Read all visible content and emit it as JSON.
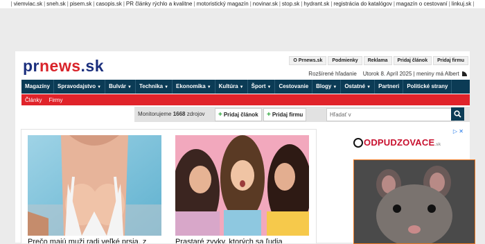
{
  "top_links": [
    "viemviac.sk",
    "sneh.sk",
    "pisem.sk",
    "casopis.sk",
    "PR články rýchlo a kvalitne",
    "motoristický magazín",
    "novinar.sk",
    "stop.sk",
    "hydrant.sk",
    "registrácia do katalógov",
    "magazín o cestovaní",
    "linkuj.sk"
  ],
  "logo": {
    "pr": "pr",
    "news": "news",
    "dot": ".",
    "sk": "sk"
  },
  "top_nav": [
    "O Prnews.sk",
    "Podmienky",
    "Reklama",
    "Pridaj článok",
    "Pridaj firmu"
  ],
  "meta": {
    "advanced_search": "Rozšírené hľadanie",
    "date": "Utorok 8. Apríl 2025",
    "separator": "|",
    "nameday": "meniny má Albert"
  },
  "main_nav": [
    {
      "label": "Magazíny",
      "dropdown": false
    },
    {
      "label": "Spravodajstvo",
      "dropdown": true
    },
    {
      "label": "Bulvár",
      "dropdown": true
    },
    {
      "label": "Technika",
      "dropdown": true
    },
    {
      "label": "Ekonomika",
      "dropdown": true
    },
    {
      "label": "Kultúra",
      "dropdown": true
    },
    {
      "label": "Šport",
      "dropdown": true
    },
    {
      "label": "Cestovanie",
      "dropdown": false
    },
    {
      "label": "Blogy",
      "dropdown": true
    },
    {
      "label": "Ostatné",
      "dropdown": true
    },
    {
      "label": "Partneri",
      "dropdown": false
    },
    {
      "label": "Politické strany",
      "dropdown": false
    }
  ],
  "sub_nav": [
    "Články",
    "Firmy"
  ],
  "toolbar": {
    "monitor_prefix": "Monitorujeme",
    "monitor_count": "1668",
    "monitor_suffix": "zdrojov",
    "add_article": "Pridaj článok",
    "add_company": "Pridaj firmu",
    "search_placeholder": "Hľadať v"
  },
  "articles": [
    {
      "title": "Prečo majú muži radi veľké prsia, z"
    },
    {
      "title": "Prastaré zvyky, ktorých sa ľudia"
    }
  ],
  "ad": {
    "brand_prefix": "O",
    "brand": "DPUDZOVACE",
    "brand_suffix": ".sk"
  },
  "colors": {
    "nav": "#0b3b55",
    "subnav": "#e0232a",
    "logo_blue": "#1b2f7d",
    "logo_red": "#d9232a"
  }
}
